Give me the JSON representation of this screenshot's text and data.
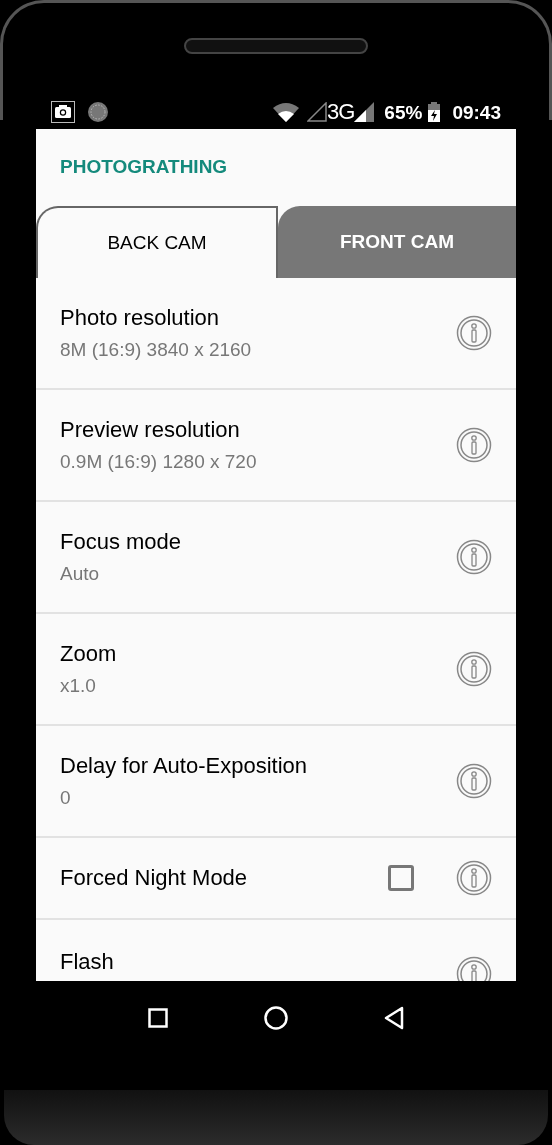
{
  "status_bar": {
    "network": "3G",
    "battery": "65%",
    "time": "09:43"
  },
  "app": {
    "title": "PHOTOGRATHING"
  },
  "tabs": [
    {
      "label": "BACK CAM",
      "selected": true
    },
    {
      "label": "FRONT CAM",
      "selected": false
    }
  ],
  "settings": [
    {
      "kind": "value",
      "title": "Photo resolution",
      "value": "8M (16:9) 3840 x 2160"
    },
    {
      "kind": "value",
      "title": "Preview resolution",
      "value": "0.9M (16:9) 1280 x 720"
    },
    {
      "kind": "value",
      "title": "Focus mode",
      "value": "Auto"
    },
    {
      "kind": "value",
      "title": "Zoom",
      "value": "x1.0"
    },
    {
      "kind": "value",
      "title": "Delay for Auto-Exposition",
      "value": "0"
    },
    {
      "kind": "checkbox",
      "title": "Forced Night Mode",
      "checked": false
    },
    {
      "kind": "value",
      "title": "Flash"
    }
  ]
}
